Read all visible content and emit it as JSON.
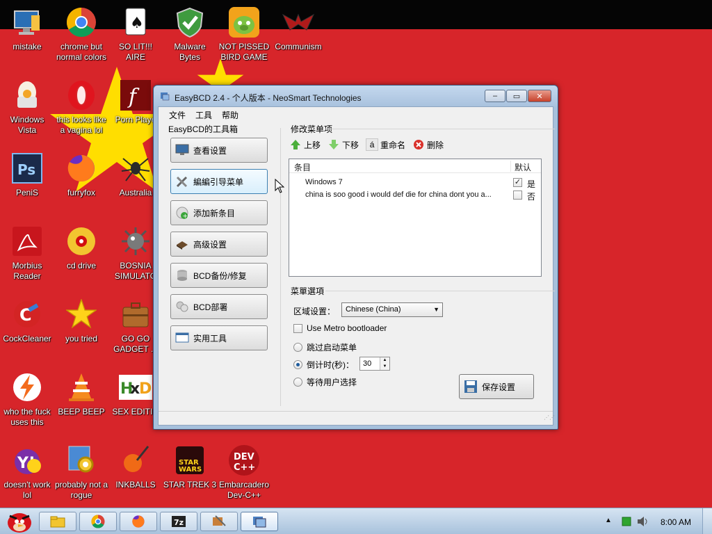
{
  "desktop": {
    "icons": [
      {
        "label": "mistake",
        "icon": "computer-icon"
      },
      {
        "label": "chrome but normal colors",
        "icon": "chrome-icon"
      },
      {
        "label": "SO LIT!!! AIRE",
        "icon": "solitaire-icon"
      },
      {
        "label": "Malware Bytes",
        "icon": "shield-icon"
      },
      {
        "label": "NOT PISSED BIRD GAME",
        "icon": "bird-game-icon"
      },
      {
        "label": "Communism",
        "icon": "communism-icon"
      },
      {
        "label": "Windows Vista",
        "icon": "egg-icon"
      },
      {
        "label": "this looks like a vagina lol",
        "icon": "opera-icon"
      },
      {
        "label": "Porn Playe",
        "icon": "flash-icon"
      },
      {
        "label": "PeniS",
        "icon": "photoshop-icon"
      },
      {
        "label": "furryfox",
        "icon": "firefox-icon"
      },
      {
        "label": "Australia",
        "icon": "spider-icon"
      },
      {
        "label": "Morbius Reader",
        "icon": "pdf-reader-icon"
      },
      {
        "label": "cd drive",
        "icon": "cd-icon"
      },
      {
        "label": "BOSNIA SIMULATO",
        "icon": "mine-icon"
      },
      {
        "label": "CockCleaner",
        "icon": "ccleaner-icon"
      },
      {
        "label": "you tried",
        "icon": "star-icon"
      },
      {
        "label": "GO GO GADGET ...",
        "icon": "briefcase-icon"
      },
      {
        "label": "who the fuck uses this",
        "icon": "avast-icon"
      },
      {
        "label": "BEEP BEEP",
        "icon": "vlc-cone-icon"
      },
      {
        "label": "SEX EDITIO",
        "icon": "hxd-icon"
      },
      {
        "label": "doesn't work lol",
        "icon": "yahoo-icon"
      },
      {
        "label": "probably not a rogue",
        "icon": "gear-shield-icon"
      },
      {
        "label": "INKBALLS",
        "icon": "inkball-icon"
      },
      {
        "label": "STAR TREK 3",
        "icon": "star-wars-icon"
      },
      {
        "label": "Embarcadero Dev-C++",
        "icon": "devcpp-icon"
      }
    ],
    "colors": {
      "wallpaper": "#d7252a",
      "star": "#ffde00"
    }
  },
  "window": {
    "title": "EasyBCD 2.4 - 个人版本 - NeoSmart Technologies",
    "controls": {
      "minimize": "–",
      "maximize": "▭",
      "close": "✕"
    },
    "menu": [
      "文件",
      "工具",
      "帮助"
    ],
    "toolbox": {
      "title": "EasyBCD的工具箱",
      "buttons": [
        {
          "label": "查看设置",
          "icon": "monitor-icon"
        },
        {
          "label": "編編引导菜单",
          "icon": "tools-icon"
        },
        {
          "label": "添加新条目",
          "icon": "add-entry-icon"
        },
        {
          "label": "高级设置",
          "icon": "chip-icon"
        },
        {
          "label": "BCD备份/修复",
          "icon": "database-icon"
        },
        {
          "label": "BCD部署",
          "icon": "deploy-icon"
        },
        {
          "label": "实用工具",
          "icon": "utility-icon"
        }
      ]
    },
    "modify": {
      "title": "修改菜单项",
      "toolbar": [
        {
          "label": "上移",
          "icon": "arrow-up-icon"
        },
        {
          "label": "下移",
          "icon": "arrow-down-icon"
        },
        {
          "label": "重命名",
          "icon": "rename-icon",
          "glyph": "á"
        },
        {
          "label": "删除",
          "icon": "delete-icon"
        }
      ],
      "columns": {
        "entry": "条目",
        "default": "默认"
      },
      "rows": [
        {
          "name": "Windows 7",
          "checked": true,
          "value": "是"
        },
        {
          "name": "china is soo good i would def die for china dont you a...",
          "checked": false,
          "value": "否"
        }
      ]
    },
    "options": {
      "title": "菜單選項",
      "locale_label": "区域设置：",
      "locale_value": "Chinese (China)",
      "metro_label": "Use Metro bootloader",
      "skip_label": "跳过启动菜单",
      "countdown_label": "倒计时(秒)：",
      "countdown_value": "30",
      "wait_label": "等待用户选择",
      "save_label": "保存设置"
    }
  },
  "taskbar": {
    "clock": "8:00 AM",
    "buttons": [
      "explorer-icon",
      "chrome-icon",
      "firefox-icon",
      "7zip-icon",
      "easybcd-icon",
      "easybcd-window-icon"
    ]
  }
}
